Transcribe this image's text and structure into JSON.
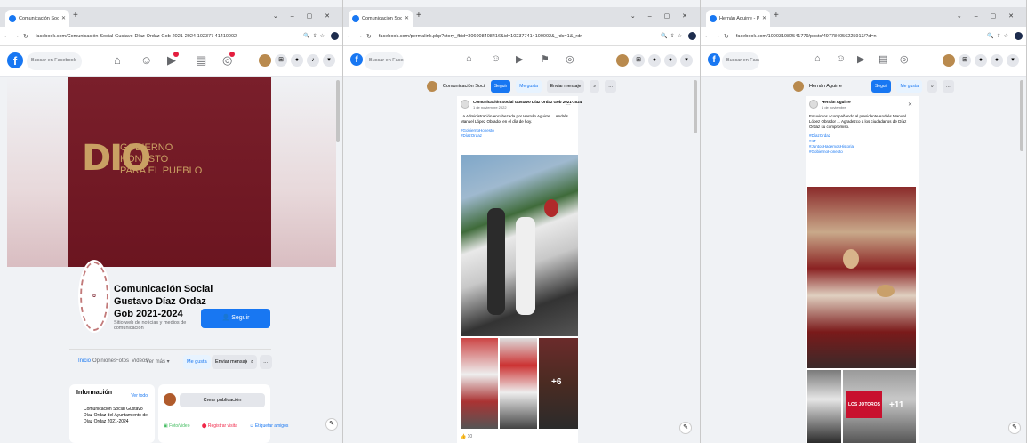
{
  "windows": [
    {
      "tab_title": "Comunicación Social Gusta",
      "url": "facebook.com/Comunicación-Social-Gustavo-Díaz-Ordaz-Gob-2021-2024-102377 41410002",
      "search_placeholder": "Buscar en Facebook",
      "cover_logo_mark": "DIO",
      "cover_logo_lines": [
        "GOBIERNO",
        "HONESTO",
        "PARA EL PUEBLO"
      ],
      "page_name": "Comunicación Social Gustavo Díaz Ordaz Gob 2021-2024",
      "page_subtitle": "Sitio web de noticias y medios de comunicación",
      "follow_label": "Seguir",
      "tabs": [
        "Inicio",
        "Opiniones",
        "Fotos",
        "Videos",
        "Ver más ▾"
      ],
      "actions": [
        "Me gusta",
        "Enviar mensaje"
      ],
      "info_title": "Información",
      "info_more": "Ver todo",
      "info_text": "Comunicación Social Gustavo Díaz Ordaz del Ayuntamiento de Díaz Ordaz 2021-2024",
      "create_label": "Crear publicación",
      "create_actions": [
        "Foto/video",
        "Registrar visita",
        "Etiquetar amigos"
      ]
    },
    {
      "tab_title": "Comunicación Social Gustavo",
      "url": "facebook.com/permalink.php?story_fbid=306008408416&id=102377414100002&_rdc=1&_rdr",
      "search_placeholder": "Buscar en Facebook",
      "sub_name": "Comunicación Social Gustavo...",
      "sub_buttons": [
        "Seguir",
        "Me gusta",
        "Enviar mensaje"
      ],
      "post_author": "Comunicación Social Gustavo Díaz Ordaz Gob 2021-2024",
      "post_time": "1 de noviembre 2022",
      "post_text": "La Administración encabezada por Hernán Aguirre ... Andrés Manuel López Obrador en el día de hoy.",
      "hashtags": [
        "#GobiernoHonesto",
        "#DíazOrdaz"
      ],
      "more_count": "+6",
      "reactions": "10"
    },
    {
      "tab_title": "Hernán Aguirre - Publicaciones",
      "url": "facebook.com/100031982541779/posts/497784056225913/?d=n",
      "search_placeholder": "Buscar en Facebook",
      "sub_name": "Hernán Aguirre",
      "sub_buttons": [
        "Seguir",
        "Me gusta"
      ],
      "post_author": "Hernán Aguirre",
      "post_time": "1 de noviembre",
      "post_text": "Estuvimos acompañando al presidente Andrés Manuel López Obrador ... Agradezco a los ciudadanos de Díaz Ordaz su compromiso.",
      "hashtags": [
        "#DíazOrdaz",
        "#4T",
        "#JuntosHacemosHistoria",
        "#GobiernoHonesto"
      ],
      "banner_text": "LOS JOTOROS",
      "more_count": "+11"
    }
  ]
}
